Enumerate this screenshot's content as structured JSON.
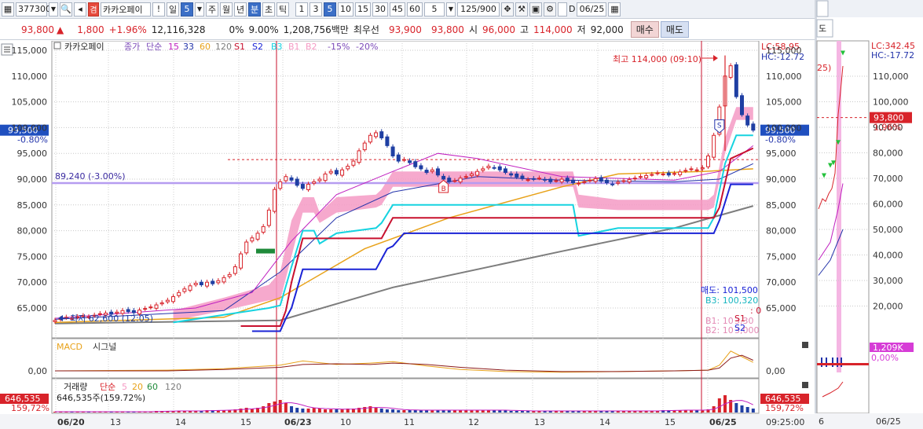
{
  "toolbar": {
    "code": "377300",
    "badge": "겸",
    "name": "카카오페이",
    "excl": "!",
    "period_day": "일",
    "period_value": "5",
    "periods": [
      "주",
      "월",
      "년",
      "분",
      "초",
      "틱"
    ],
    "intervals": [
      "1",
      "3",
      "5",
      "10",
      "15",
      "30",
      "45",
      "60"
    ],
    "count": "5",
    "range": "125/900",
    "checkbox_label": "D",
    "date": "06/25"
  },
  "pricerow": {
    "price": "93,800",
    "change_arrow": "▲",
    "change": "1,800",
    "change_pct": "+1.96%",
    "volume": "12,116,328",
    "zero_pct": "0%",
    "rate": "9.00%",
    "amount": "1,208,756백만",
    "best_label": "최우선",
    "ask": "93,900",
    "bid": "93,800",
    "open_label": "시",
    "open": "96,000",
    "high_label": "고",
    "high": "114,000",
    "low_label": "저",
    "low": "92,000",
    "buy_button": "매수",
    "sell_button": "매도"
  },
  "chart": {
    "legend_name": "카카오페이",
    "legend_items": [
      "종가",
      "단순",
      "15",
      "33",
      "60",
      "120",
      "S1",
      "S2",
      "B3",
      "B1",
      "B2",
      "-15%",
      "-20%"
    ],
    "y_ticks": [
      "115,000",
      "110,000",
      "105,000",
      "100,000",
      "95,000",
      "90,000",
      "85,000",
      "80,000",
      "75,000",
      "70,000",
      "65,000"
    ],
    "current_price_box": "99,500",
    "current_pct": "-0.80%",
    "level_label": "89,240 (-3.00%)",
    "high_annotation": "최고 114,000 (09:10)",
    "low_annotation": "최저 62,600 (12:05)",
    "lc": "LC:58.95",
    "hc": "HC:-12.72",
    "side_sell": "매도: 101,500",
    "side_b3": "B3: 100,320",
    "side_zero": ": 0",
    "side_s1": "S1",
    "side_s2": "S2",
    "side_b1": "B1: 10",
    "side_b2": "B2: 10",
    "side_b1_tail": "3,30",
    "side_b2_tail": "3,000",
    "macd_label": "MACD",
    "signal_label": "시그널",
    "macd_zero": "0,00",
    "volume_label": "거래량",
    "volume_items": [
      "단순",
      "5",
      "20",
      "60",
      "120"
    ],
    "volume_value": "646,535주(159.72%)",
    "volume_box": "646,535",
    "volume_pct": "159,72%",
    "x_labels": [
      "06/20",
      "13",
      "14",
      "15",
      "06/23",
      "10",
      "11",
      "12",
      "13",
      "14",
      "15",
      "06/25"
    ],
    "time_label": "09:25:00",
    "s_marker": "S",
    "b_marker": "B"
  },
  "right_panel": {
    "tab_label": "도",
    "lc": "LC:342.45",
    "hc": "HC:-17.72",
    "y_ticks": [
      "110,000",
      "100,000",
      "90,000",
      "80,000",
      "70,000",
      "60,000",
      "50,000",
      "40,000",
      "30,000",
      "20,000"
    ],
    "price_box": "93,800",
    "price_pct": "1,96%",
    "vol_box": "1,209K",
    "vol_pct": "0,00%",
    "pct_fragment": "25)",
    "x_labels": [
      "6",
      "06/25"
    ]
  },
  "colors": {
    "accent": "#3b6fc7",
    "up": "#d8232a",
    "down": "#1f3fa3",
    "pink_band": "#f59ac4",
    "cyan": "#16d3e0",
    "orange": "#e8a21a",
    "dark_red": "#c8102e",
    "blue": "#1a23d6",
    "grey": "#7d7d7d",
    "purple_line": "#b69cf0"
  }
}
